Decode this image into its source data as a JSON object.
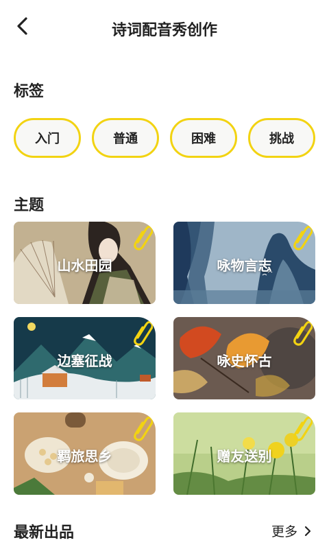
{
  "header": {
    "title": "诗词配音秀创作"
  },
  "tags": {
    "title": "标签",
    "items": [
      "入门",
      "普通",
      "困难",
      "挑战"
    ]
  },
  "topics": {
    "title": "主题",
    "items": [
      "山水田园",
      "咏物言志",
      "边塞征战",
      "咏史怀古",
      "羁旅思乡",
      "赠友送别"
    ]
  },
  "latest": {
    "title": "最新出品",
    "more_label": "更多"
  },
  "colors": {
    "accent": "#f2d312"
  }
}
